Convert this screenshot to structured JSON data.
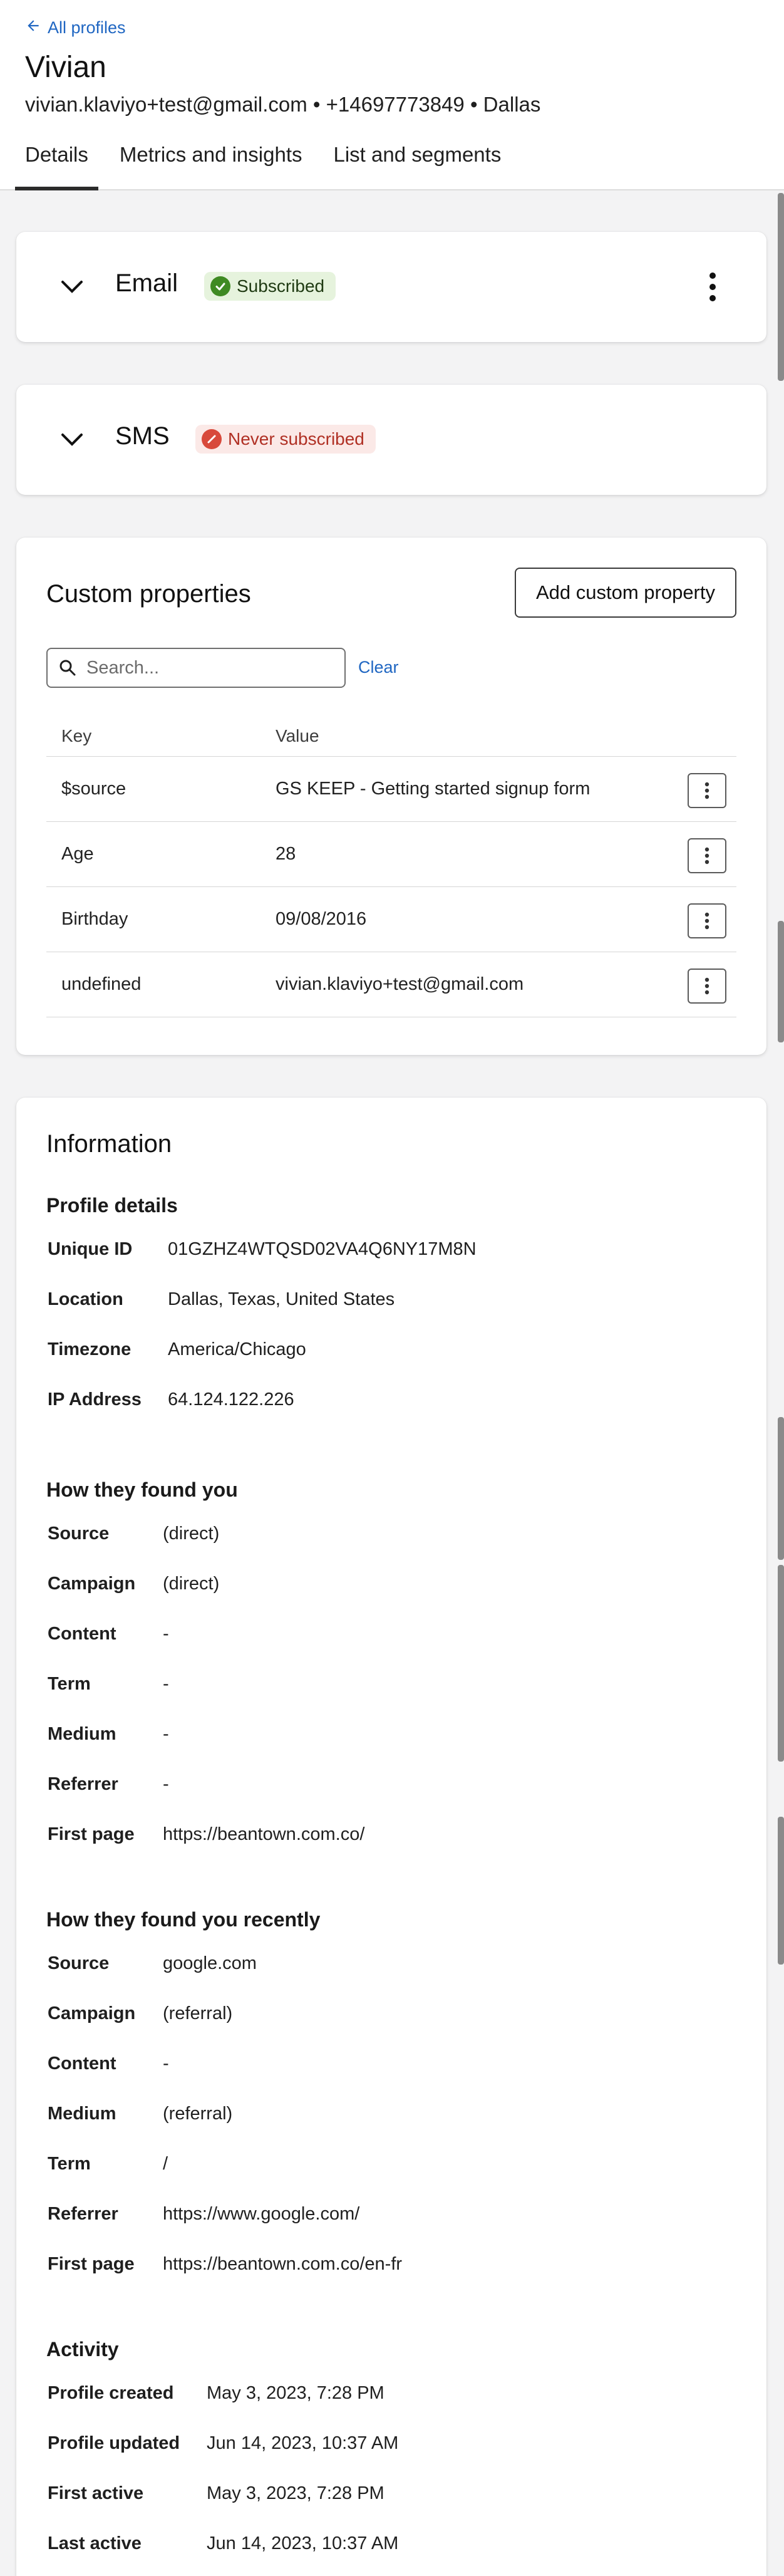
{
  "header": {
    "back_label": "All profiles",
    "name": "Vivian",
    "meta": "vivian.klaviyo+test@gmail.com • +14697773849 • Dallas",
    "tabs": [
      "Details",
      "Metrics and insights",
      "List and segments"
    ]
  },
  "email_card": {
    "title": "Email",
    "status": "Subscribed"
  },
  "sms_card": {
    "title": "SMS",
    "status": "Never subscribed"
  },
  "custom_properties": {
    "title": "Custom properties",
    "add_button": "Add custom property",
    "search_placeholder": "Search...",
    "clear_label": "Clear",
    "columns": [
      "Key",
      "Value"
    ],
    "rows": [
      {
        "key": "$source",
        "value": "GS KEEP - Getting started signup form"
      },
      {
        "key": "Age",
        "value": "28"
      },
      {
        "key": "Birthday",
        "value": "09/08/2016"
      },
      {
        "key": "undefined",
        "value": "vivian.klaviyo+test@gmail.com"
      }
    ]
  },
  "information": {
    "title": "Information",
    "profile_details": {
      "title": "Profile details",
      "rows": [
        {
          "label": "Unique ID",
          "value": "01GZHZ4WTQSD02VA4Q6NY17M8N"
        },
        {
          "label": "Location",
          "value": "Dallas, Texas, United States"
        },
        {
          "label": "Timezone",
          "value": "America/Chicago"
        },
        {
          "label": "IP Address",
          "value": "64.124.122.226"
        }
      ]
    },
    "found_you": {
      "title": "How they found you",
      "rows": [
        {
          "label": "Source",
          "value": "(direct)"
        },
        {
          "label": "Campaign",
          "value": "(direct)"
        },
        {
          "label": "Content",
          "value": "-"
        },
        {
          "label": "Term",
          "value": "-"
        },
        {
          "label": "Medium",
          "value": "-"
        },
        {
          "label": "Referrer",
          "value": "-"
        },
        {
          "label": "First page",
          "value": "https://beantown.com.co/"
        }
      ]
    },
    "found_you_recently": {
      "title": "How they found you recently",
      "rows": [
        {
          "label": "Source",
          "value": "google.com"
        },
        {
          "label": "Campaign",
          "value": "(referral)"
        },
        {
          "label": "Content",
          "value": "-"
        },
        {
          "label": "Medium",
          "value": "(referral)"
        },
        {
          "label": "Term",
          "value": "/"
        },
        {
          "label": "Referrer",
          "value": "https://www.google.com/"
        },
        {
          "label": "First page",
          "value": "https://beantown.com.co/en-fr"
        }
      ]
    },
    "activity": {
      "title": "Activity",
      "rows": [
        {
          "label": "Profile created",
          "value": "May 3, 2023, 7:28 PM"
        },
        {
          "label": "Profile updated",
          "value": "Jun 14, 2023, 10:37 AM"
        },
        {
          "label": "First active",
          "value": "May 3, 2023, 7:28 PM"
        },
        {
          "label": "Last active",
          "value": "Jun 14, 2023, 10:37 AM"
        }
      ]
    }
  },
  "colors": {
    "link": "#1f66c2",
    "subscribed_bg": "#e6f3dd",
    "subscribed_icon": "#3f8a23",
    "never_bg": "#fbe9e7",
    "never_icon": "#d8493b"
  }
}
